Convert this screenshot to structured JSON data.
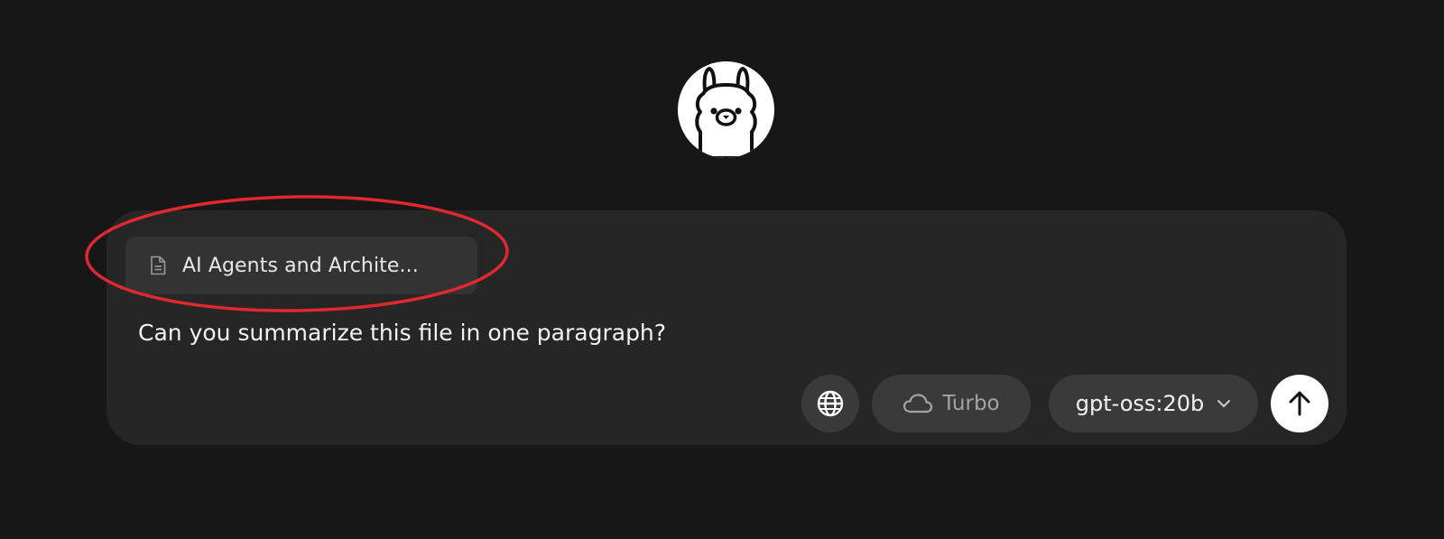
{
  "app": {
    "logo_icon": "ollama-llama-icon"
  },
  "composer": {
    "attachment": {
      "icon": "document-icon",
      "name": "AI Agents and Archite..."
    },
    "prompt": "Can you summarize this file in one paragraph?",
    "toolbar": {
      "web_search_icon": "globe-icon",
      "turbo_icon": "cloud-icon",
      "turbo_label": "Turbo",
      "model_label": "gpt-oss:20b",
      "model_dropdown_icon": "chevron-down-icon",
      "send_icon": "arrow-up-icon"
    }
  },
  "annotation": {
    "color": "#e0282e",
    "shape": "ellipse"
  },
  "colors": {
    "background": "#171717",
    "composer_bg": "#262626",
    "pill_bg": "#3a3a3a",
    "attachment_bg": "#333333",
    "send_bg": "#ffffff"
  }
}
